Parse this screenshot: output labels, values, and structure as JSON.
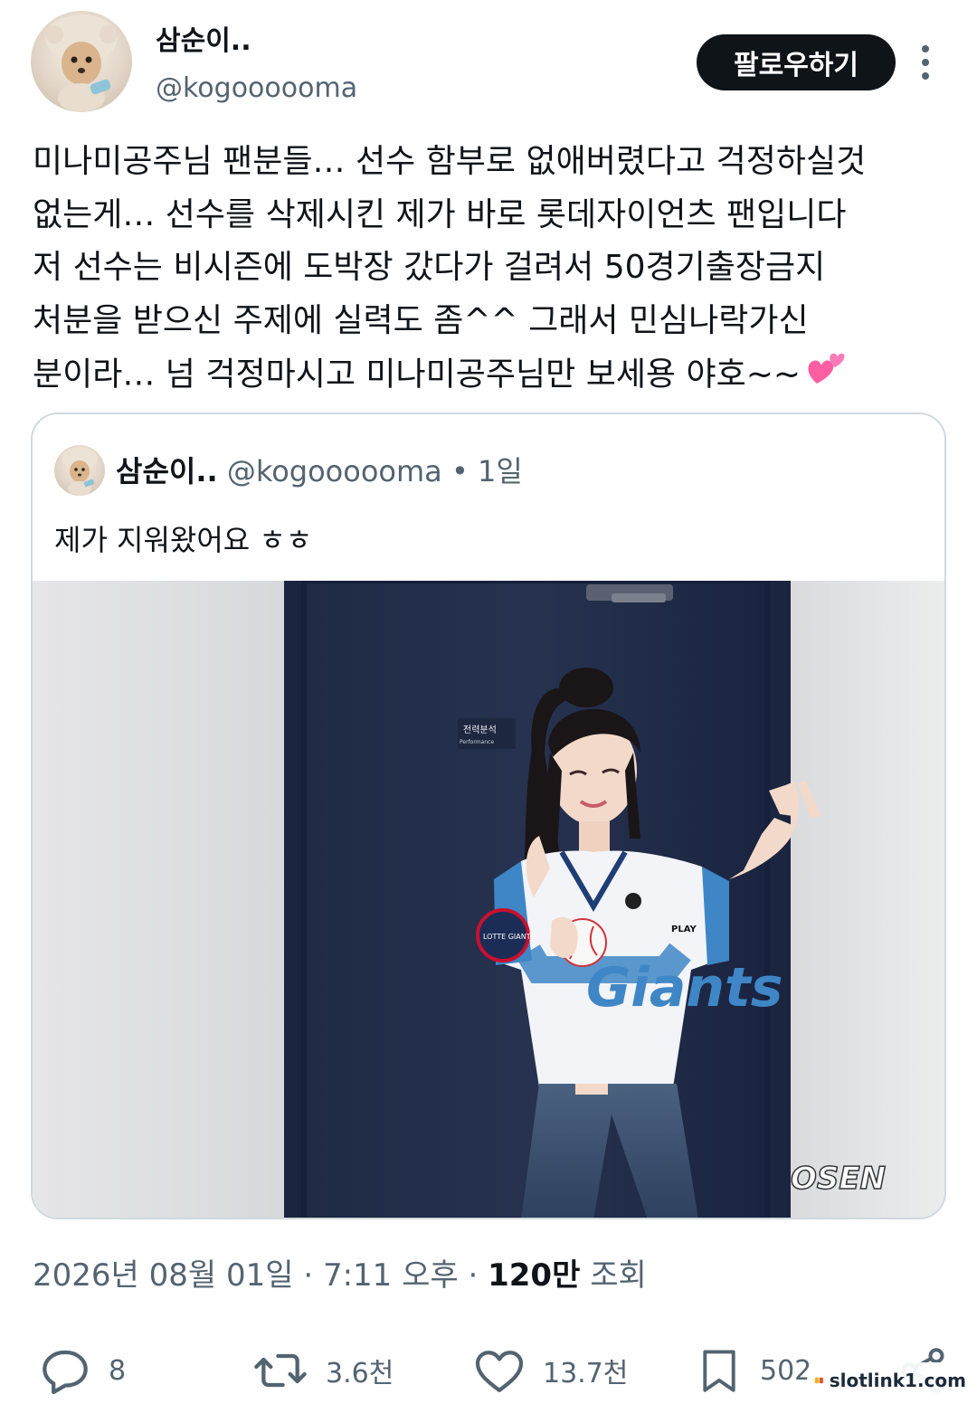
{
  "author": {
    "display_name": "삼순이..",
    "handle": "@kogoooooma",
    "avatar_icon": "dog-avatar-icon"
  },
  "follow_button": {
    "label": "팔로우하기"
  },
  "post": {
    "lines": [
      "미나미공주님 팬분들… 선수 함부로 없애버렸다고 걱정하실것",
      "없는게… 선수를 삭제시킨 제가 바로 롯데자이언츠 팬입니다",
      "저 선수는 비시즌에 도박장 갔다가 걸려서 50경기출장금지",
      "처분을 받으신 주제에 실력도 좀^^ 그래서 민심나락가신",
      "분이라… 넘 걱정마시고 미나미공주님만 보세용 야호~~"
    ],
    "emoji": "two-hearts-icon"
  },
  "quoted": {
    "display_name": "삼순이..",
    "handle": "@kogoooooma",
    "separator": "•",
    "time": "1일",
    "text": "제가 지워왔어요 ㅎㅎ",
    "image": {
      "door_sign": "전력분석",
      "door_sign_sub": "Performance",
      "jersey_text": "Giants",
      "jersey_patch": "LOTTE GIANTS",
      "sponsor_mark": "PLAY",
      "watermark": "OSEN"
    }
  },
  "meta": {
    "date": "2026년 08월 01일",
    "dot1": "·",
    "time": "7:11 오후",
    "dot2": "·",
    "views_num": "120만",
    "views_label": "조회"
  },
  "actions": {
    "reply": {
      "icon": "reply-icon",
      "count": "8"
    },
    "retweet": {
      "icon": "retweet-icon",
      "count": "3.6천"
    },
    "like": {
      "icon": "heart-icon",
      "count": "13.7천"
    },
    "bookmark": {
      "icon": "bookmark-icon",
      "count": "502"
    },
    "share": {
      "icon": "share-icon"
    }
  },
  "site_watermark": {
    "text": "slotlink1.com"
  },
  "colors": {
    "text_primary": "#0f1419",
    "text_secondary": "#536471",
    "border": "#cfd9de",
    "button_bg": "#0f1419",
    "heart_pink": "#ff5fa2"
  }
}
